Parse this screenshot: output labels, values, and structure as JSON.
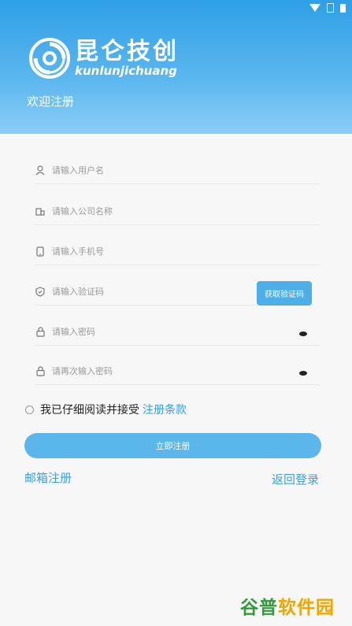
{
  "brand": {
    "name_cn": "昆仑技创",
    "name_en": "kunlunjichuang",
    "welcome": "欢迎注册"
  },
  "form": {
    "username_placeholder": "请输入用户名",
    "company_placeholder": "请输入公司名称",
    "phone_placeholder": "请输入手机号",
    "code_placeholder": "请输入验证码",
    "get_code_label": "获取验证码",
    "password_placeholder": "请输入密码",
    "confirm_password_placeholder": "请再次输入密码"
  },
  "agreement": {
    "text": "我已仔细阅读并接受",
    "terms_link": "注册条款"
  },
  "actions": {
    "register_button": "立即注册",
    "email_register": "邮箱注册",
    "back_to_login": "返回登录"
  },
  "watermark": {
    "part1": "谷普",
    "part2": "软件园"
  },
  "colors": {
    "primary": "#2f9fe6",
    "button": "#5bb6ec",
    "header_light": "#8ccdf5"
  }
}
